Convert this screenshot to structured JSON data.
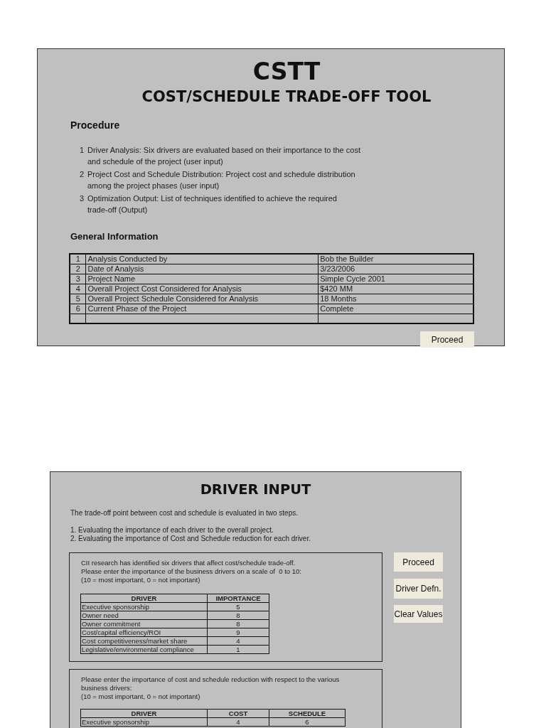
{
  "summary_panel": {
    "title": "CSTT",
    "subtitle": "COST/SCHEDULE TRADE-OFF TOOL",
    "procedure": {
      "heading": "Procedure",
      "steps": [
        {
          "number": "1",
          "text": "Driver Analysis: Six drivers are evaluated based on their importance to the cost\nand schedule of the project (user input)"
        },
        {
          "number": "2",
          "text": "Project Cost and Schedule Distribution: Project cost and schedule distribution\namong the project phases (user input)"
        },
        {
          "number": "3",
          "text": "Optimization Output: List of techniques identified to achieve the required\ntrade-off (Output)"
        }
      ]
    },
    "general_information": {
      "heading": "General Information",
      "rows": [
        {
          "number": "1",
          "label": "Analysis Conducted by",
          "value": "Bob the Builder"
        },
        {
          "number": "2",
          "label": "Date of Analysis",
          "value": "3/23/2006"
        },
        {
          "number": "3",
          "label": "Project Name",
          "value": "Simple Cycle 2001"
        },
        {
          "number": "4",
          "label": "Overall Project Cost Considered for Analysis",
          "value": "$420 MM"
        },
        {
          "number": "5",
          "label": "Overall Project Schedule Considered for Analysis",
          "value": "18 Months"
        },
        {
          "number": "6",
          "label": "Current Phase of the Project",
          "value": "Complete"
        }
      ]
    },
    "button": "Proceed"
  },
  "driver_input_panel": {
    "title": "DRIVER INPUT",
    "intro": "The trade-off point between cost and schedule is evaluated in two steps.",
    "steps": [
      "1. Evaluating the importance of each driver to the overall project.",
      "2. Evaluating the importance of Cost and Schedule reduction for each driver."
    ],
    "driver_importance": {
      "instructions": [
        "CII research has identified six drivers that affect cost/schedule trade-off.",
        "Please enter the importance of the business drivers on a scale of  0 to 10:",
        "(10 = most important, 0 = not important)"
      ],
      "columns": [
        "DRIVER",
        "IMPORTANCE"
      ],
      "rows": [
        [
          "Executive sponsorship",
          "5"
        ],
        [
          "Owner need",
          "8"
        ],
        [
          "Owner commitment",
          "8"
        ],
        [
          "Cost/capital efficiency/ROI",
          "9"
        ],
        [
          "Cost competitiveness/market share",
          "4"
        ],
        [
          "Legislative/environmental compliance",
          "1"
        ]
      ]
    },
    "reduction_importance": {
      "instructions": [
        "Please enter the importance of cost and schedule reduction with respect to the various\nbusiness drivers:",
        "(10 = most important, 0 = not important)"
      ],
      "columns": [
        "DRIVER",
        "COST",
        "SCHEDULE"
      ],
      "rows": [
        [
          "Executive sponsorship",
          "4",
          "6"
        ]
      ]
    },
    "buttons": [
      "Proceed",
      "Driver Defn.",
      "Clear Values"
    ]
  }
}
